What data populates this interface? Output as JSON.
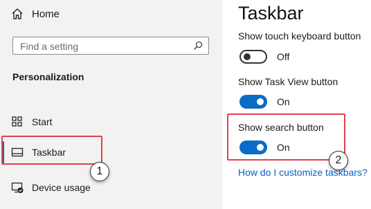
{
  "sidebar": {
    "home_label": "Home",
    "search_placeholder": "Find a setting",
    "section_title": "Personalization",
    "items": [
      {
        "label": "Start",
        "icon": "start-icon"
      },
      {
        "label": "Taskbar",
        "icon": "taskbar-icon",
        "selected": true
      },
      {
        "label": "Device usage",
        "icon": "device-usage-icon"
      }
    ]
  },
  "content": {
    "title": "Taskbar",
    "settings": [
      {
        "label": "Show touch keyboard button",
        "state": "Off",
        "on": false
      },
      {
        "label": "Show Task View button",
        "state": "On",
        "on": true
      },
      {
        "label": "Show search button",
        "state": "On",
        "on": true
      }
    ],
    "help_link": "How do I customize taskbars?"
  },
  "annotations": {
    "badge_1": "1",
    "badge_2": "2",
    "highlight_color": "#e0424b"
  },
  "colors": {
    "accent": "#0a6cc8",
    "sidebar_bg": "#f2f2f2",
    "link": "#0a60c6"
  }
}
